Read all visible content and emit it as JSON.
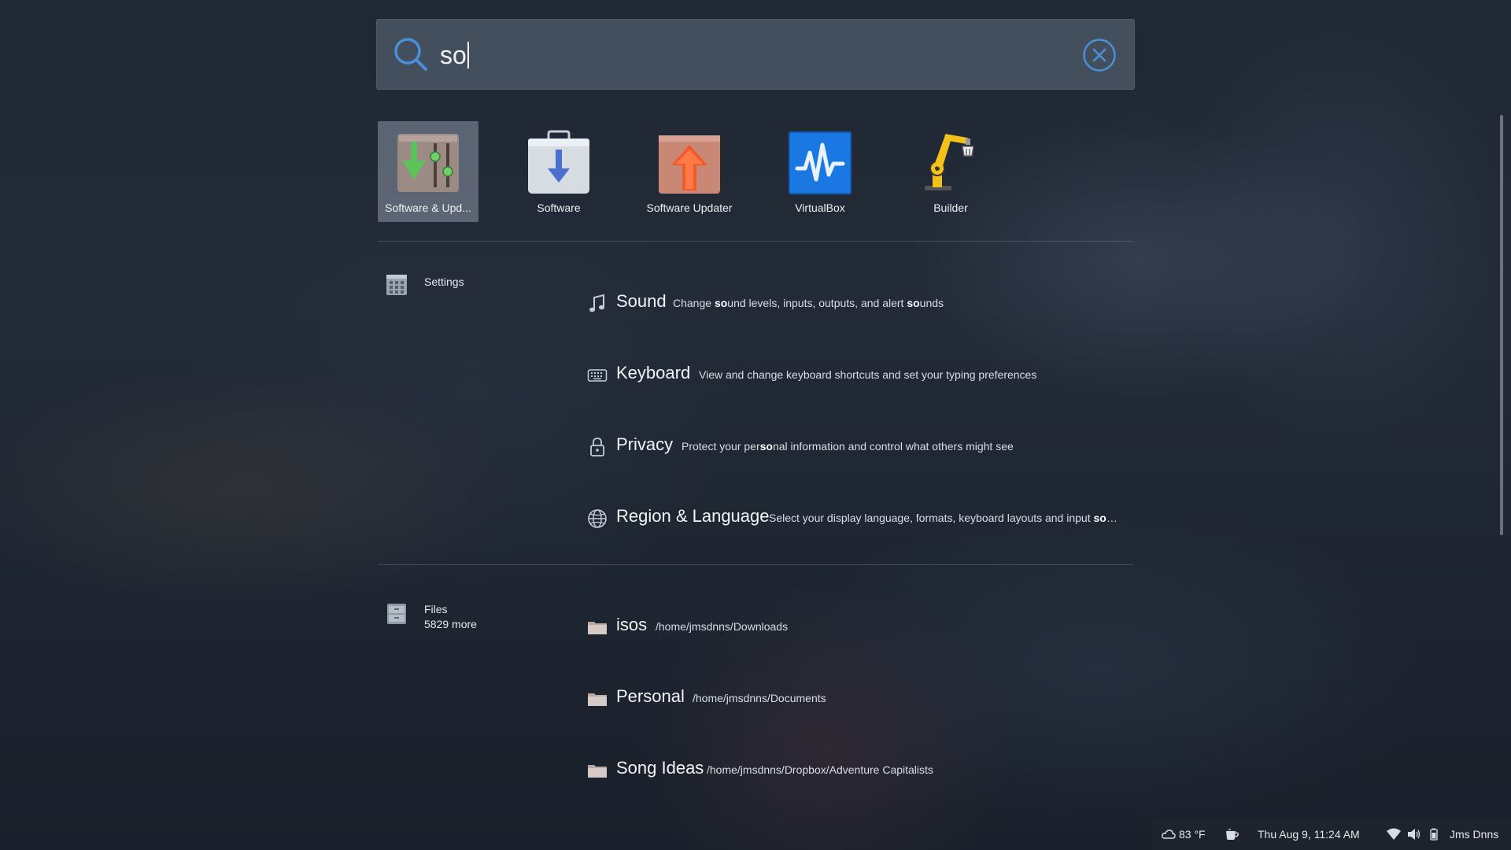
{
  "search": {
    "query": "so"
  },
  "apps": [
    {
      "label": "Software & Upd...",
      "icon": "software-properties-icon",
      "selected": true
    },
    {
      "label": "Software",
      "icon": "software-center-icon",
      "selected": false
    },
    {
      "label": "Software Updater",
      "icon": "software-updater-icon",
      "selected": false
    },
    {
      "label": "VirtualBox",
      "icon": "virtualbox-icon",
      "selected": false
    },
    {
      "label": "Builder",
      "icon": "builder-icon",
      "selected": false
    }
  ],
  "settings": {
    "category": "Settings",
    "results": [
      {
        "title": "Sound",
        "icon": "music-note-icon",
        "desc_parts": [
          "Change ",
          "so",
          "und levels, inputs, outputs, and alert ",
          "so",
          "unds"
        ]
      },
      {
        "title": "Keyboard",
        "icon": "keyboard-icon",
        "desc_parts": [
          "View and change keyboard shortcuts and set your typing preferences",
          "",
          "",
          "",
          ""
        ]
      },
      {
        "title": "Privacy",
        "icon": "lock-icon",
        "desc_parts": [
          "Protect your per",
          "so",
          "nal information and control what others might see",
          "",
          ""
        ]
      },
      {
        "title": "Region & Language",
        "icon": "globe-icon",
        "desc_parts": [
          "Select your display language, formats, keyboard layouts and input ",
          "so",
          "…",
          "",
          ""
        ]
      }
    ]
  },
  "files": {
    "category": "Files",
    "more": "5829 more",
    "results": [
      {
        "title": "isos",
        "path": "/home/jmsdnns/Downloads",
        "icon": "folder-icon"
      },
      {
        "title": "Personal",
        "path": "/home/jmsdnns/Documents",
        "icon": "folder-icon"
      },
      {
        "title": "Song Ideas",
        "path": "/home/jmsdnns/Dropbox/Adventure Capitalists",
        "icon": "folder-icon"
      }
    ]
  },
  "panel": {
    "weather": "83 °F",
    "clock": "Thu Aug  9, 11:24 AM",
    "user": "Jms Dnns"
  },
  "colors": {
    "accent": "#4a90d9",
    "selection": "#8c96a5"
  }
}
